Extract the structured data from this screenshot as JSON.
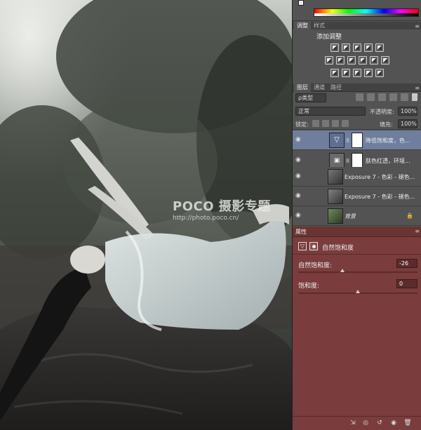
{
  "watermark": {
    "brand": "POCO 摄影专题",
    "url": "http://photo.poco.cn/"
  },
  "adjustments_panel": {
    "tabs": [
      "调整",
      "样式"
    ],
    "title": "添加调整"
  },
  "layers_panel": {
    "tabs": [
      "图层",
      "通道",
      "路径"
    ],
    "filter_kind": "ρ类型",
    "blend_mode": "正常",
    "opacity_label": "不透明度:",
    "opacity_value": "100%",
    "lock_label": "锁定:",
    "fill_label": "填充:",
    "fill_value": "100%",
    "layers": [
      {
        "name": "降低饱和度，色...",
        "selected": true
      },
      {
        "name": "肤色红透，环境...",
        "selected": false
      },
      {
        "name": "Exposure 7 - 色彩 - 褪色...",
        "selected": false
      },
      {
        "name": "Exposure 7 - 色彩 - 褪色...",
        "selected": false
      },
      {
        "name": "背景",
        "selected": false
      }
    ]
  },
  "properties_panel": {
    "tab": "属性",
    "title": "自然饱和度",
    "vibrance_label": "自然饱和度:",
    "vibrance_value": "-26",
    "vibrance_level": -26,
    "saturation_label": "饱和度:",
    "saturation_value": "0",
    "saturation_level": 0
  },
  "colors": {
    "panel_bg": "#535353",
    "properties_bg": "#7a3c3c",
    "selected_layer": "#6e7e9c"
  }
}
